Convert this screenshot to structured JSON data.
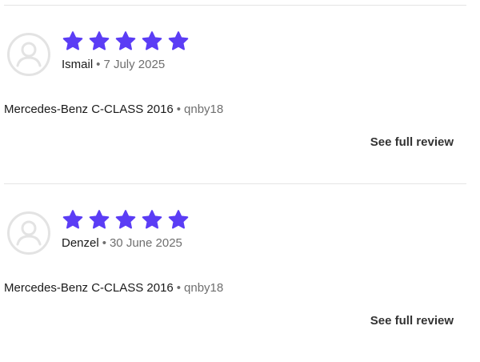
{
  "colors": {
    "star": "#5b3df5",
    "divider": "#e4e4e4",
    "muted_text": "#6f6f6f"
  },
  "separator": "•",
  "reviews": [
    {
      "rating": 5,
      "reviewer": "Ismail",
      "date": "7 July 2025",
      "vehicle": "Mercedes-Benz C-CLASS 2016",
      "username": "qnby18",
      "cta_label": "See full review",
      "avatar_icon": "user-avatar-icon"
    },
    {
      "rating": 5,
      "reviewer": "Denzel",
      "date": "30 June 2025",
      "vehicle": "Mercedes-Benz C-CLASS 2016",
      "username": "qnby18",
      "cta_label": "See full review",
      "avatar_icon": "user-avatar-icon"
    }
  ]
}
